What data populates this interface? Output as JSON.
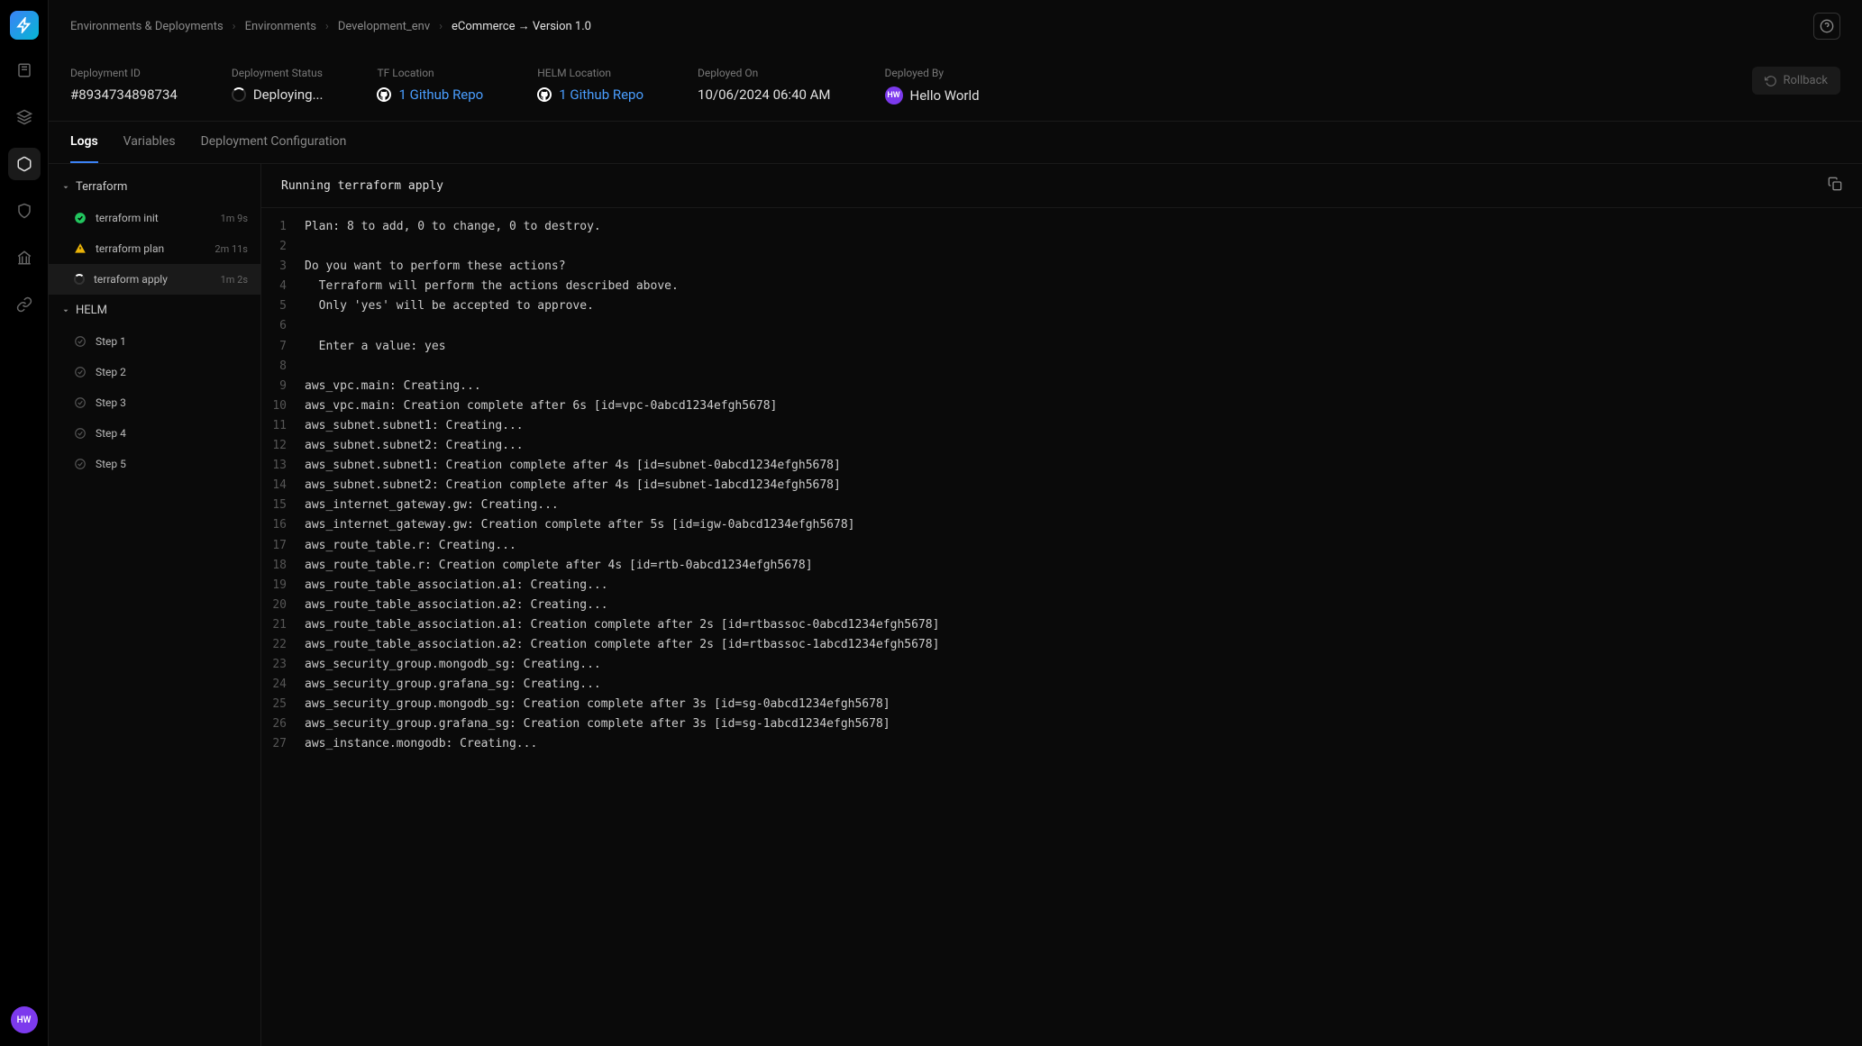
{
  "breadcrumb": [
    "Environments & Deployments",
    "Environments",
    "Development_env",
    "eCommerce → Version 1.0"
  ],
  "rail_avatar": "HW",
  "meta": {
    "deployment_id_label": "Deployment ID",
    "deployment_id": "#8934734898734",
    "status_label": "Deployment Status",
    "status": "Deploying...",
    "tf_label": "TF Location",
    "tf_link": "1 Github Repo",
    "helm_label": "HELM Location",
    "helm_link": "1 Github Repo",
    "deployed_on_label": "Deployed On",
    "deployed_on": "10/06/2024 06:40 AM",
    "deployed_by_label": "Deployed By",
    "deployed_by_initials": "HW",
    "deployed_by": "Hello World",
    "rollback": "Rollback"
  },
  "tabs": [
    "Logs",
    "Variables",
    "Deployment Configuration"
  ],
  "groups": [
    {
      "name": "Terraform",
      "steps": [
        {
          "name": "terraform init",
          "duration": "1m 9s",
          "status": "success"
        },
        {
          "name": "terraform plan",
          "duration": "2m 11s",
          "status": "warning"
        },
        {
          "name": "terraform apply",
          "duration": "1m 2s",
          "status": "running",
          "active": true
        }
      ]
    },
    {
      "name": "HELM",
      "steps": [
        {
          "name": "Step 1",
          "duration": "",
          "status": "pending"
        },
        {
          "name": "Step 2",
          "duration": "",
          "status": "pending"
        },
        {
          "name": "Step 3",
          "duration": "",
          "status": "pending"
        },
        {
          "name": "Step 4",
          "duration": "",
          "status": "pending"
        },
        {
          "name": "Step 5",
          "duration": "",
          "status": "pending"
        }
      ]
    }
  ],
  "log_title": "Running terraform apply",
  "log_lines": [
    "Plan: 8 to add, 0 to change, 0 to destroy.",
    "",
    "Do you want to perform these actions?",
    "  Terraform will perform the actions described above.",
    "  Only 'yes' will be accepted to approve.",
    "",
    "  Enter a value: yes",
    "",
    "aws_vpc.main: Creating...",
    "aws_vpc.main: Creation complete after 6s [id=vpc-0abcd1234efgh5678]",
    "aws_subnet.subnet1: Creating...",
    "aws_subnet.subnet2: Creating...",
    "aws_subnet.subnet1: Creation complete after 4s [id=subnet-0abcd1234efgh5678]",
    "aws_subnet.subnet2: Creation complete after 4s [id=subnet-1abcd1234efgh5678]",
    "aws_internet_gateway.gw: Creating...",
    "aws_internet_gateway.gw: Creation complete after 5s [id=igw-0abcd1234efgh5678]",
    "aws_route_table.r: Creating...",
    "aws_route_table.r: Creation complete after 4s [id=rtb-0abcd1234efgh5678]",
    "aws_route_table_association.a1: Creating...",
    "aws_route_table_association.a2: Creating...",
    "aws_route_table_association.a1: Creation complete after 2s [id=rtbassoc-0abcd1234efgh5678]",
    "aws_route_table_association.a2: Creation complete after 2s [id=rtbassoc-1abcd1234efgh5678]",
    "aws_security_group.mongodb_sg: Creating...",
    "aws_security_group.grafana_sg: Creating...",
    "aws_security_group.mongodb_sg: Creation complete after 3s [id=sg-0abcd1234efgh5678]",
    "aws_security_group.grafana_sg: Creation complete after 3s [id=sg-1abcd1234efgh5678]",
    "aws_instance.mongodb: Creating..."
  ]
}
